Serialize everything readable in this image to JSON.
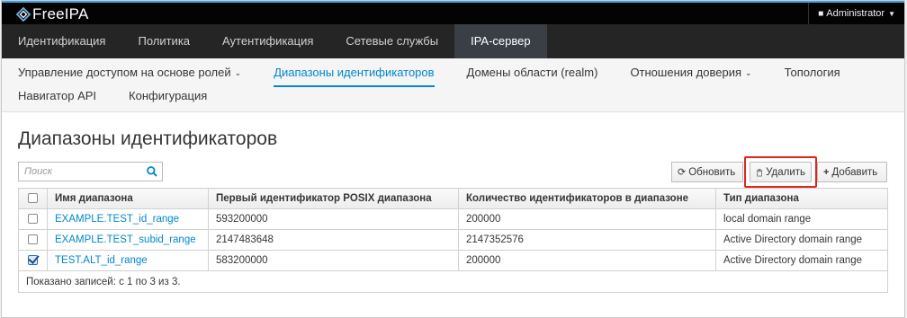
{
  "brand": {
    "name": "FreeIPA"
  },
  "user_menu": {
    "label": "Administrator",
    "icon": "user-icon"
  },
  "primary_nav": [
    {
      "label": "Идентификация",
      "active": false
    },
    {
      "label": "Политика",
      "active": false
    },
    {
      "label": "Аутентификация",
      "active": false
    },
    {
      "label": "Сетевые службы",
      "active": false
    },
    {
      "label": "IPA-сервер",
      "active": true
    }
  ],
  "secondary_nav": {
    "row1": [
      {
        "label": "Управление доступом на основе ролей",
        "dropdown": true,
        "active": false
      },
      {
        "label": "Диапазоны идентификаторов",
        "dropdown": false,
        "active": true
      },
      {
        "label": "Домены области (realm)",
        "dropdown": false,
        "active": false
      },
      {
        "label": "Отношения доверия",
        "dropdown": true,
        "active": false
      },
      {
        "label": "Топология",
        "dropdown": false,
        "active": false
      }
    ],
    "row2": [
      {
        "label": "Навигатор API",
        "dropdown": false,
        "active": false
      },
      {
        "label": "Конфигурация",
        "dropdown": false,
        "active": false
      }
    ]
  },
  "page": {
    "title": "Диапазоны идентификаторов"
  },
  "search": {
    "placeholder": "Поиск",
    "value": ""
  },
  "toolbar": {
    "refresh_label": "Обновить",
    "delete_label": "Удалить",
    "add_label": "Добавить"
  },
  "table": {
    "columns": [
      "Имя диапазона",
      "Первый идентификатор POSIX диапазона",
      "Количество идентификаторов в диапазоне",
      "Тип диапазона"
    ],
    "rows": [
      {
        "checked": false,
        "name": "EXAMPLE.TEST_id_range",
        "first_id": "593200000",
        "count": "200000",
        "type": "local domain range"
      },
      {
        "checked": false,
        "name": "EXAMPLE.TEST_subid_range",
        "first_id": "2147483648",
        "count": "2147352576",
        "type": "Active Directory domain range"
      },
      {
        "checked": true,
        "name": "TEST.ALT_id_range",
        "first_id": "583200000",
        "count": "200000",
        "type": "Active Directory domain range"
      }
    ],
    "footer": "Показано записей: с 1 по 3 из 3."
  },
  "colors": {
    "accent": "#0088ce",
    "topbar": "#030303",
    "primary_nav": "#252525",
    "primary_nav_active": "#393f44",
    "highlight": "#e0261c"
  }
}
